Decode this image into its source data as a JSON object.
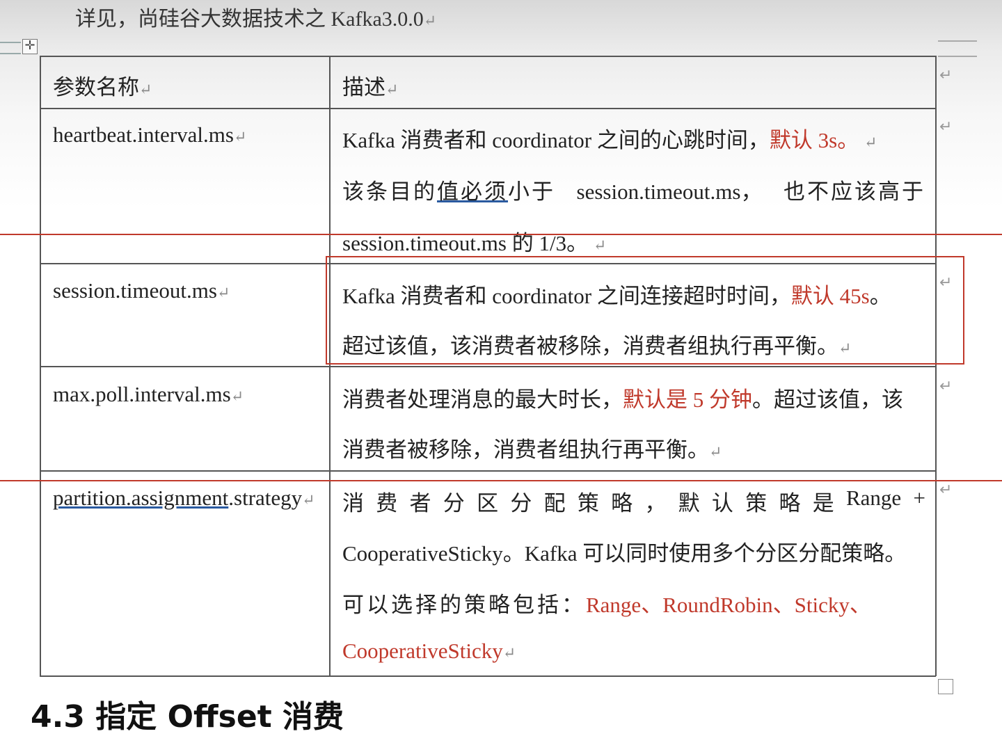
{
  "intro": "详见，尚硅谷大数据技术之 Kafka3.0.0",
  "para_mark": "↵",
  "table_handle_icon": "move-cross-icon",
  "header": {
    "name": "参数名称",
    "desc": "描述"
  },
  "rows": {
    "r1": {
      "name": "heartbeat.interval.ms",
      "l1_a": "Kafka 消费者和 coordinator 之间的心跳时间，",
      "l1_red": "默认 3s",
      "l1_b": "。",
      "l2_a": "该条目的",
      "l2_u": "值必须",
      "l2_b": "小于",
      "l2_c": "session.timeout.ms，",
      "l2_d": "也不应该高于",
      "l3": "session.timeout.ms 的 1/3。"
    },
    "r2": {
      "name": "session.timeout.ms",
      "l1_a": "Kafka 消费者和 coordinator 之间连接超时时间，",
      "l1_red": "默认 45s",
      "l1_b": "。",
      "l2": "超过该值，该消费者被移除，消费者组执行再平衡。"
    },
    "r3": {
      "name": "max.poll.interval.ms",
      "l1_a": "消费者处理消息的最大时长，",
      "l1_red": "默认是 5 分钟",
      "l1_b": "。超过该值，该",
      "l2": "消费者被移除，消费者组执行再平衡。"
    },
    "r4": {
      "name_u": "partition.assignment",
      "name_b": ".strategy",
      "l1": [
        "消",
        "费",
        "者",
        "分",
        "区",
        "分",
        "配",
        "策",
        "略",
        "，",
        "默",
        "认",
        "策",
        "略",
        "是",
        "Range",
        "+"
      ],
      "l2": "CooperativeSticky。Kafka 可以同时使用多个分区分配策略。",
      "l3_a": "可以选择的策略包括：",
      "l3_red": "Range、RoundRobin、Sticky、",
      "l4_red": "CooperativeSticky"
    }
  },
  "next_heading": "4.3 指定 Offset 消费"
}
